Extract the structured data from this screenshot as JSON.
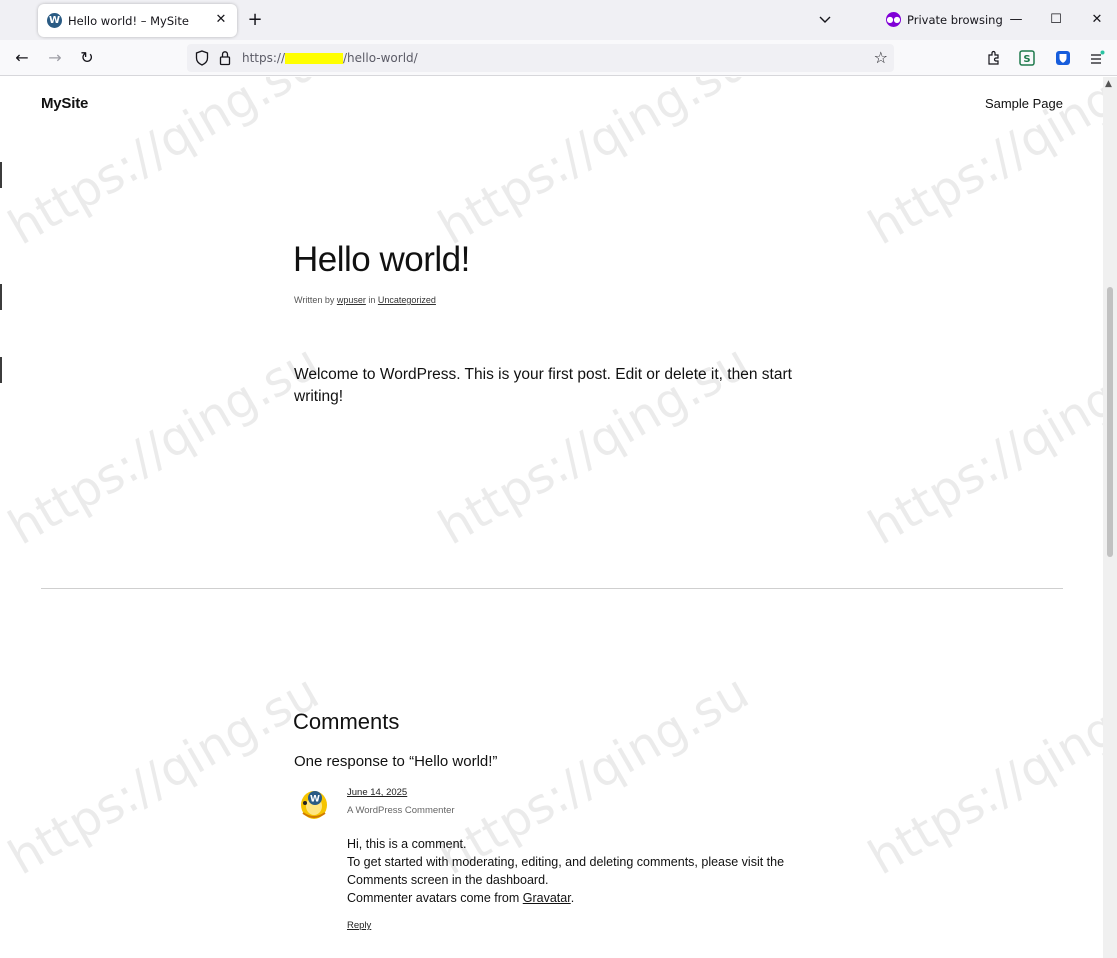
{
  "browser": {
    "tab_title": "Hello world! – MySite",
    "tab_favicon": "W",
    "new_tab": "+",
    "private_label": "Private browsing",
    "url_prefix": "https://",
    "url_path": "/hello-world/"
  },
  "site": {
    "title": "MySite",
    "nav_link": "Sample Page"
  },
  "post": {
    "title": "Hello world!",
    "meta_written_by": "Written by ",
    "author": "wpuser",
    "meta_in": " in ",
    "category": "Uncategorized",
    "body": "Welcome to WordPress. This is your first post. Edit or delete it, then start writing!"
  },
  "comments": {
    "heading": "Comments",
    "response_heading": "One response to “Hello world!”",
    "items": [
      {
        "date": "June 14, 2025",
        "author": "A WordPress Commenter",
        "line1": "Hi, this is a comment.",
        "line2": "To get started with moderating, editing, and deleting comments, please visit the Comments screen in the dashboard.",
        "line3_prefix": "Commenter avatars come from ",
        "line3_link": "Gravatar",
        "line3_suffix": ".",
        "reply": "Reply"
      }
    ]
  },
  "watermark_text": "https://qing.su",
  "colors": {
    "private_purple": "#8000d7",
    "url_redaction": "#ffff00",
    "tab_bar": "#f0f0f4"
  }
}
